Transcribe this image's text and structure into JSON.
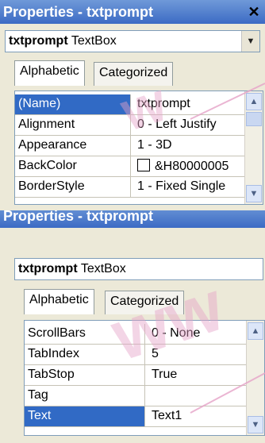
{
  "panel_top": {
    "title": "Properties - txtprompt",
    "close_glyph": "✕",
    "object": {
      "name": "txtprompt",
      "type": "TextBox"
    },
    "tabs": [
      {
        "label": "Alphabetic"
      },
      {
        "label": "Categorized"
      }
    ],
    "rows": [
      {
        "name": "(Name)",
        "value": "txtprompt"
      },
      {
        "name": "Alignment",
        "value": "0 - Left Justify"
      },
      {
        "name": "Appearance",
        "value": "1 - 3D"
      },
      {
        "name": "BackColor",
        "value": "&H80000005"
      },
      {
        "name": "BorderStyle",
        "value": "1 - Fixed Single"
      }
    ]
  },
  "panel_bottom": {
    "title": "Properties - txtprompt",
    "object": {
      "name": "txtprompt",
      "type": "TextBox"
    },
    "tabs": [
      {
        "label": "Alphabetic"
      },
      {
        "label": "Categorized"
      }
    ],
    "rows": [
      {
        "name": "ScrollBars",
        "value": "0 - None"
      },
      {
        "name": "TabIndex",
        "value": "5"
      },
      {
        "name": "TabStop",
        "value": "True"
      },
      {
        "name": "Tag",
        "value": ""
      },
      {
        "name": "Text",
        "value": "Text1"
      }
    ]
  },
  "colors": {
    "title_bar": "#3C6BC4",
    "selection": "#316AC5",
    "watermark": "#E6A3C8"
  },
  "icons": {
    "dropdown": "chevron-down-icon",
    "scroll_up": "chevron-up-icon",
    "scroll_down": "chevron-down-icon"
  }
}
